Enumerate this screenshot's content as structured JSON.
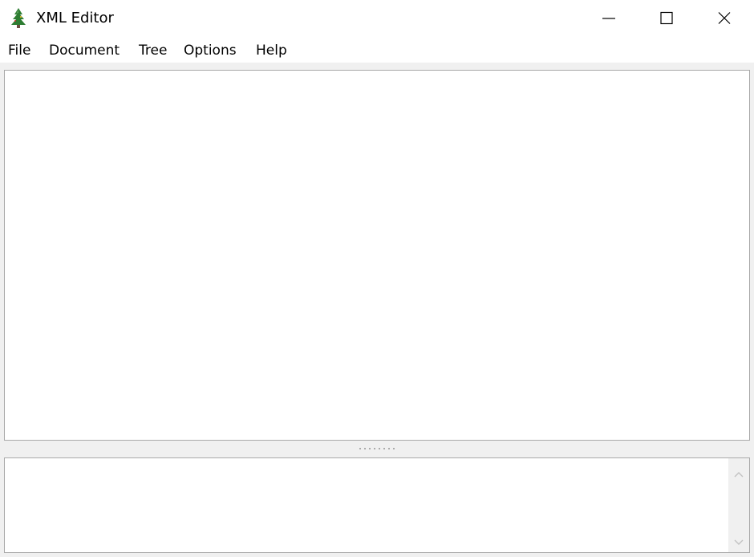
{
  "window": {
    "title": "XML Editor",
    "app_icon": "tree-icon",
    "controls": {
      "minimize_icon": "minimize-icon",
      "maximize_icon": "maximize-icon",
      "close_icon": "close-icon"
    }
  },
  "menubar": {
    "items": [
      {
        "label": "File"
      },
      {
        "label": "Document"
      },
      {
        "label": "Tree"
      },
      {
        "label": "Options"
      },
      {
        "label": "Help"
      }
    ]
  },
  "main_pane": {
    "content": ""
  },
  "bottom_pane": {
    "content": "",
    "scroll_up_icon": "chevron-up-icon",
    "scroll_down_icon": "chevron-down-icon"
  },
  "colors": {
    "window_bg": "#f0f0f0",
    "pane_border": "#a9a9a9",
    "tree_green": "#2e7d32"
  }
}
